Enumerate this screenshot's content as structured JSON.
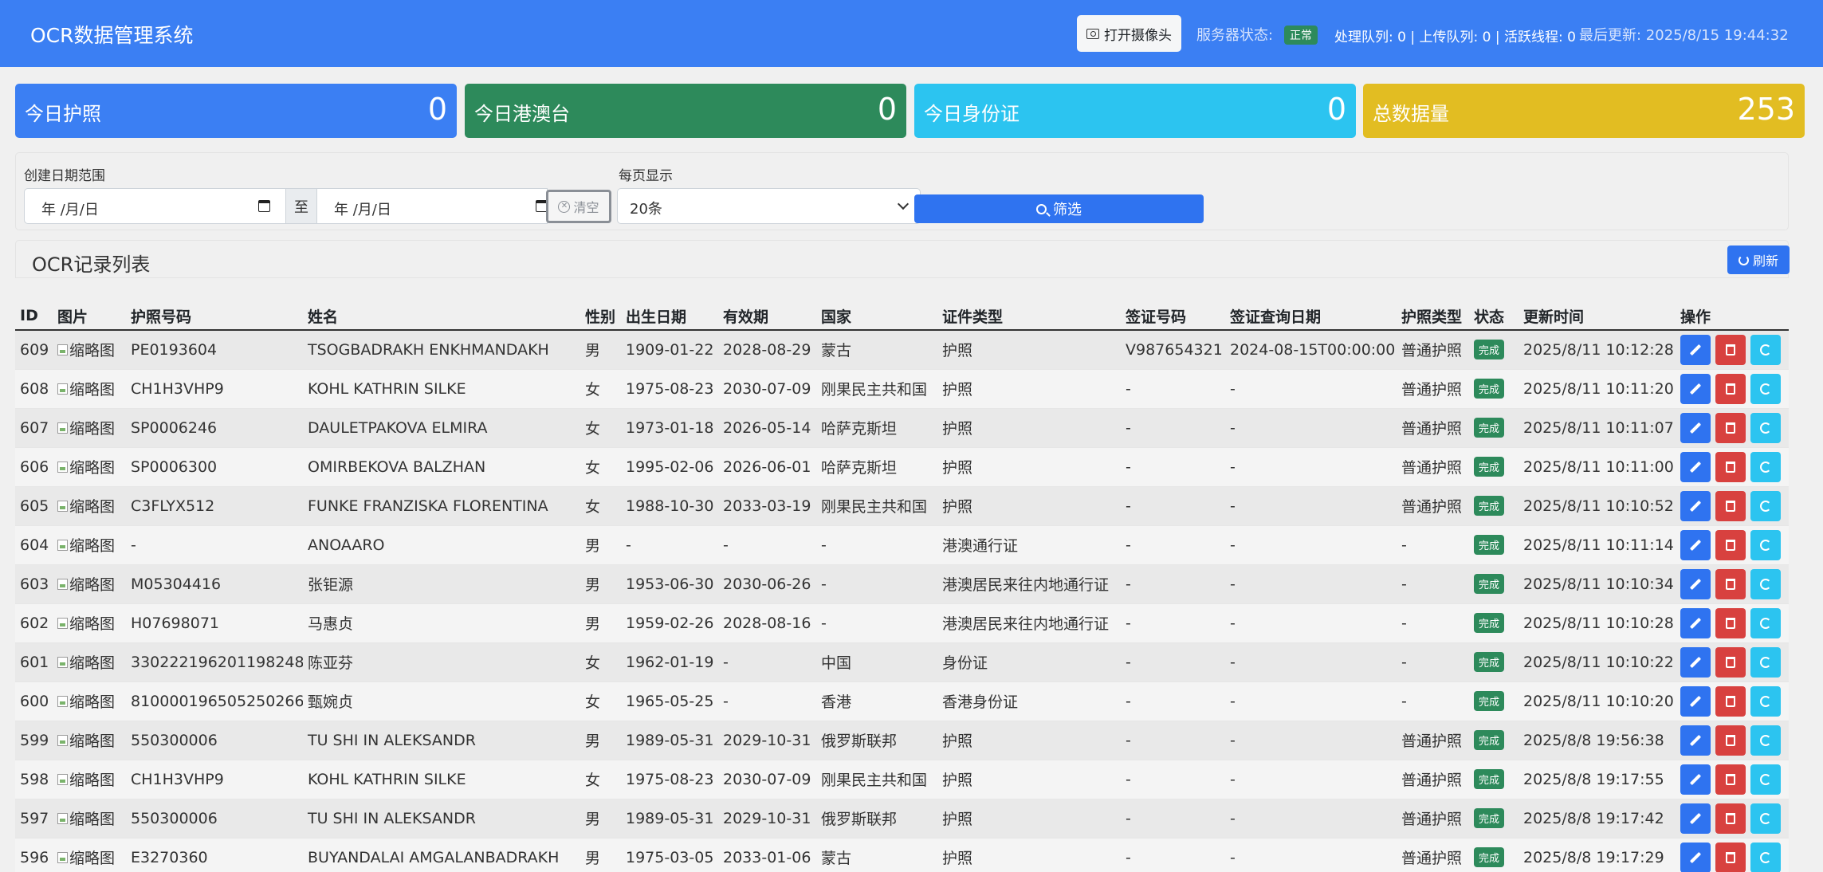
{
  "header": {
    "title": "OCR数据管理系统",
    "camera_label": "打开摄像头",
    "server_label": "服务器状态:",
    "server_status": "正常",
    "queues": "处理队列: 0 | 上传队列: 0 | 活跃线程: 0",
    "last_update": "最后更新: 2025/8/15 19:44:32"
  },
  "stats": [
    {
      "label": "今日护照",
      "value": "0",
      "color": "#3b7ff3"
    },
    {
      "label": "今日港澳台",
      "value": "0",
      "color": "#2d8a5b"
    },
    {
      "label": "今日身份证",
      "value": "0",
      "color": "#2cc4f0"
    },
    {
      "label": "总数据量",
      "value": "253",
      "color": "#e2bd22"
    }
  ],
  "filters": {
    "date_range_label": "创建日期范围",
    "date_placeholder": "年 /月/日",
    "to_label": "至",
    "clear_label": "清空",
    "page_size_label": "每页显示",
    "page_size": "20条",
    "filter_button": "筛选"
  },
  "list": {
    "title": "OCR记录列表",
    "refresh_label": "刷新",
    "columns": [
      "ID",
      "图片",
      "护照号码",
      "姓名",
      "性别",
      "出生日期",
      "有效期",
      "国家",
      "证件类型",
      "签证号码",
      "签证查询日期",
      "护照类型",
      "状态",
      "更新时间",
      "操作"
    ],
    "image_alt": "缩略图",
    "status_done": "完成",
    "rows": [
      {
        "id": "609",
        "passport": "PE0193604",
        "name": "TSOGBADRAKH ENKHMANDAKH",
        "gender": "男",
        "birth": "1909-01-22",
        "expiry": "2028-08-29",
        "country": "蒙古",
        "doc_type": "护照",
        "visa_no": "V987654321",
        "visa_date": "2024-08-15T00:00:00",
        "passport_type": "普通护照",
        "updated": "2025/8/11 10:12:28"
      },
      {
        "id": "608",
        "passport": "CH1H3VHP9",
        "name": "KOHL KATHRIN SILKE",
        "gender": "女",
        "birth": "1975-08-23",
        "expiry": "2030-07-09",
        "country": "刚果民主共和国",
        "doc_type": "护照",
        "visa_no": "-",
        "visa_date": "-",
        "passport_type": "普通护照",
        "updated": "2025/8/11 10:11:20"
      },
      {
        "id": "607",
        "passport": "SP0006246",
        "name": "DAULETPAKOVA ELMIRA",
        "gender": "女",
        "birth": "1973-01-18",
        "expiry": "2026-05-14",
        "country": "哈萨克斯坦",
        "doc_type": "护照",
        "visa_no": "-",
        "visa_date": "-",
        "passport_type": "普通护照",
        "updated": "2025/8/11 10:11:07"
      },
      {
        "id": "606",
        "passport": "SP0006300",
        "name": "OMIRBEKOVA BALZHAN",
        "gender": "女",
        "birth": "1995-02-06",
        "expiry": "2026-06-01",
        "country": "哈萨克斯坦",
        "doc_type": "护照",
        "visa_no": "-",
        "visa_date": "-",
        "passport_type": "普通护照",
        "updated": "2025/8/11 10:11:00"
      },
      {
        "id": "605",
        "passport": "C3FLYX512",
        "name": "FUNKE FRANZISKA FLORENTINA",
        "gender": "女",
        "birth": "1988-10-30",
        "expiry": "2033-03-19",
        "country": "刚果民主共和国",
        "doc_type": "护照",
        "visa_no": "-",
        "visa_date": "-",
        "passport_type": "普通护照",
        "updated": "2025/8/11 10:10:52"
      },
      {
        "id": "604",
        "passport": "-",
        "name": "ANOAARO",
        "gender": "男",
        "birth": "-",
        "expiry": "-",
        "country": "-",
        "doc_type": "港澳通行证",
        "visa_no": "-",
        "visa_date": "-",
        "passport_type": "-",
        "updated": "2025/8/11 10:11:14"
      },
      {
        "id": "603",
        "passport": "M05304416",
        "name": "张钜源",
        "gender": "男",
        "birth": "1953-06-30",
        "expiry": "2030-06-26",
        "country": "-",
        "doc_type": "港澳居民来往内地通行证",
        "visa_no": "-",
        "visa_date": "-",
        "passport_type": "-",
        "updated": "2025/8/11 10:10:34"
      },
      {
        "id": "602",
        "passport": "H07698071",
        "name": "马惠贞",
        "gender": "男",
        "birth": "1959-02-26",
        "expiry": "2028-08-16",
        "country": "-",
        "doc_type": "港澳居民来往内地通行证",
        "visa_no": "-",
        "visa_date": "-",
        "passport_type": "-",
        "updated": "2025/8/11 10:10:28"
      },
      {
        "id": "601",
        "passport": "330222196201198248",
        "name": "陈亚芬",
        "gender": "女",
        "birth": "1962-01-19",
        "expiry": "-",
        "country": "中国",
        "doc_type": "身份证",
        "visa_no": "-",
        "visa_date": "-",
        "passport_type": "-",
        "updated": "2025/8/11 10:10:22"
      },
      {
        "id": "600",
        "passport": "810000196505250266",
        "name": "甄婉贞",
        "gender": "女",
        "birth": "1965-05-25",
        "expiry": "-",
        "country": "香港",
        "doc_type": "香港身份证",
        "visa_no": "-",
        "visa_date": "-",
        "passport_type": "-",
        "updated": "2025/8/11 10:10:20"
      },
      {
        "id": "599",
        "passport": "550300006",
        "name": "TU SHI IN ALEKSANDR",
        "gender": "男",
        "birth": "1989-05-31",
        "expiry": "2029-10-31",
        "country": "俄罗斯联邦",
        "doc_type": "护照",
        "visa_no": "-",
        "visa_date": "-",
        "passport_type": "普通护照",
        "updated": "2025/8/8 19:56:38"
      },
      {
        "id": "598",
        "passport": "CH1H3VHP9",
        "name": "KOHL KATHRIN SILKE",
        "gender": "女",
        "birth": "1975-08-23",
        "expiry": "2030-07-09",
        "country": "刚果民主共和国",
        "doc_type": "护照",
        "visa_no": "-",
        "visa_date": "-",
        "passport_type": "普通护照",
        "updated": "2025/8/8 19:17:55"
      },
      {
        "id": "597",
        "passport": "550300006",
        "name": "TU SHI IN ALEKSANDR",
        "gender": "男",
        "birth": "1989-05-31",
        "expiry": "2029-10-31",
        "country": "俄罗斯联邦",
        "doc_type": "护照",
        "visa_no": "-",
        "visa_date": "-",
        "passport_type": "普通护照",
        "updated": "2025/8/8 19:17:42"
      },
      {
        "id": "596",
        "passport": "E3270360",
        "name": "BUYANDALAI AMGALANBADRAKH",
        "gender": "男",
        "birth": "1975-03-05",
        "expiry": "2033-01-06",
        "country": "蒙古",
        "doc_type": "护照",
        "visa_no": "-",
        "visa_date": "-",
        "passport_type": "普通护照",
        "updated": "2025/8/8 19:17:29"
      }
    ]
  }
}
